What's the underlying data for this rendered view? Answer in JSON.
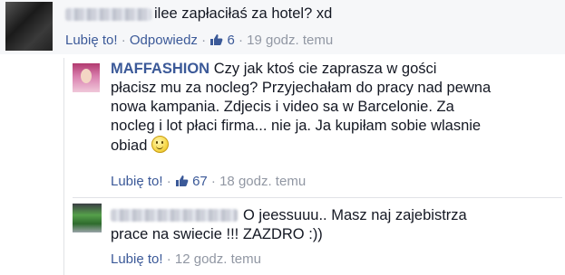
{
  "comments": [
    {
      "author": "",
      "text": "ilee zapłaciłaś za hotel? xd",
      "like_label": "Lubię to!",
      "reply_label": "Odpowiedz",
      "likes": "6",
      "time": "19 godz. temu"
    },
    {
      "author": "MAFFASHION",
      "text_line1": "Czy jak ktoś cie zaprasza w gości",
      "text_line2": "płacisz mu za nocleg? Przyjechałam do pracy nad pewna",
      "text_line3": "nowa kampania. Zdjecis i video sa w Barcelonie. Za",
      "text_line4": "nocleg i lot płaci firma... nie ja. Ja kupiłam sobie wlasnie",
      "text_line5": "obiad",
      "emoji": "smile-emoji",
      "like_label": "Lubię to!",
      "likes": "67",
      "time": "18 godz. temu"
    },
    {
      "author": "",
      "text_line1": "O jeessuuu.. Masz naj zajebistrza",
      "text_line2": "prace na swiecie !!! ZAZDRO :))",
      "like_label": "Lubię to!",
      "time": "12 godz. temu"
    }
  ],
  "separator": "·",
  "colors": {
    "link": "#3b5998",
    "meta": "#9197a3",
    "text": "#141823",
    "top_bg": "#f6f7f9"
  }
}
